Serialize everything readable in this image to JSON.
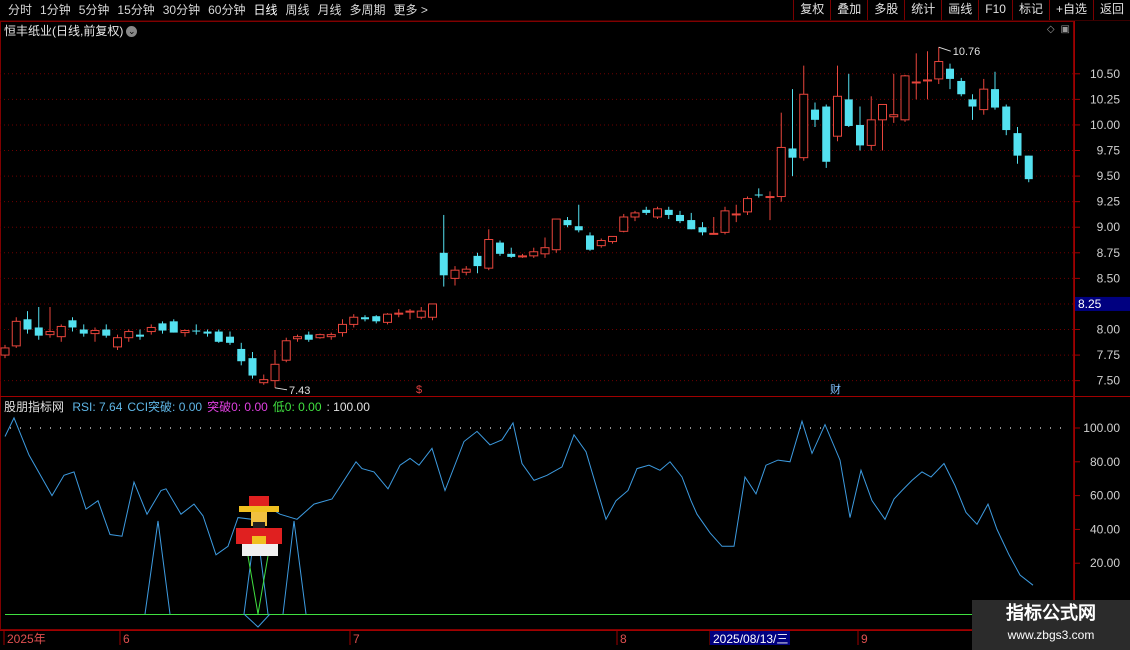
{
  "toolbar": {
    "periods": [
      "分时",
      "1分钟",
      "5分钟",
      "15分钟",
      "30分钟",
      "60分钟",
      "日线",
      "周线",
      "月线",
      "多周期",
      "更多 >"
    ],
    "active_index": 6,
    "right_buttons": [
      "复权",
      "叠加",
      "多股",
      "统计",
      "画线",
      "F10",
      "标记",
      "+自选",
      "返回"
    ]
  },
  "header": {
    "title": "恒丰纸业(日线,前复权)",
    "dropdown_icon": "chevron-down-icon",
    "right_icons": [
      "diamond-icon",
      "window-icon"
    ]
  },
  "price_axis": {
    "ticks": [
      "10.50",
      "10.25",
      "10.00",
      "9.75",
      "9.50",
      "9.25",
      "9.00",
      "8.75",
      "8.50",
      "8.25",
      "8.00",
      "7.75",
      "7.50"
    ],
    "current_price": "8.25",
    "current_price_color": "#000080"
  },
  "annotations": {
    "high_label": "10.76",
    "low_label": "7.43",
    "event_mark_1": "$",
    "event_mark_2": "财"
  },
  "indicator": {
    "name": "股朋指标网",
    "items": [
      {
        "text": "RSI: 7.64",
        "color": "#5fb6e6"
      },
      {
        "text": "CCI突破: 0.00",
        "color": "#5fb6e6"
      },
      {
        "text": "突破0: 0.00",
        "color": "#e040e0"
      },
      {
        "text": "低0: 0.00",
        "color": "#40e040"
      },
      {
        "text": ": 100.00",
        "color": "#e0e0e0"
      }
    ],
    "axis_ticks": [
      "100.00",
      "80.00",
      "60.00",
      "40.00",
      "20.00"
    ]
  },
  "time_axis": {
    "labels": [
      "2025年",
      "6",
      "7",
      "8",
      "2025/08/13/三",
      "9"
    ]
  },
  "watermark": {
    "line1": "指标公式网",
    "line2": "www.zbgs3.com"
  },
  "colors": {
    "up": "#e8453c",
    "down": "#54e1f0",
    "grid": "#6e0000",
    "rsi": "#3d9be0",
    "zero_line": "#40e040"
  },
  "chart_data": {
    "type": "candlestick",
    "y_range": [
      7.35,
      10.85
    ],
    "candles": [
      {
        "o": 7.75,
        "h": 7.85,
        "l": 7.72,
        "c": 7.82
      },
      {
        "o": 7.84,
        "h": 8.12,
        "l": 7.82,
        "c": 8.08
      },
      {
        "o": 8.1,
        "h": 8.18,
        "l": 7.96,
        "c": 8.0
      },
      {
        "o": 8.02,
        "h": 8.22,
        "l": 7.9,
        "c": 7.94
      },
      {
        "o": 7.95,
        "h": 8.22,
        "l": 7.92,
        "c": 7.98
      },
      {
        "o": 7.93,
        "h": 8.05,
        "l": 7.88,
        "c": 8.03
      },
      {
        "o": 8.09,
        "h": 8.12,
        "l": 7.98,
        "c": 8.02
      },
      {
        "o": 8.0,
        "h": 8.05,
        "l": 7.93,
        "c": 7.96
      },
      {
        "o": 7.96,
        "h": 8.02,
        "l": 7.88,
        "c": 7.99
      },
      {
        "o": 8.0,
        "h": 8.05,
        "l": 7.92,
        "c": 7.94
      },
      {
        "o": 7.83,
        "h": 7.95,
        "l": 7.8,
        "c": 7.92
      },
      {
        "o": 7.92,
        "h": 8.0,
        "l": 7.88,
        "c": 7.98
      },
      {
        "o": 7.95,
        "h": 8.0,
        "l": 7.9,
        "c": 7.93
      },
      {
        "o": 7.98,
        "h": 8.05,
        "l": 7.95,
        "c": 8.02
      },
      {
        "o": 8.06,
        "h": 8.08,
        "l": 7.96,
        "c": 7.99
      },
      {
        "o": 8.08,
        "h": 8.1,
        "l": 7.97,
        "c": 7.97
      },
      {
        "o": 7.97,
        "h": 8.0,
        "l": 7.93,
        "c": 7.99
      },
      {
        "o": 7.99,
        "h": 8.05,
        "l": 7.95,
        "c": 7.98
      },
      {
        "o": 7.98,
        "h": 8.0,
        "l": 7.93,
        "c": 7.96
      },
      {
        "o": 7.98,
        "h": 8.0,
        "l": 7.87,
        "c": 7.88
      },
      {
        "o": 7.93,
        "h": 7.98,
        "l": 7.85,
        "c": 7.87
      },
      {
        "o": 7.81,
        "h": 7.87,
        "l": 7.65,
        "c": 7.69
      },
      {
        "o": 7.72,
        "h": 7.78,
        "l": 7.52,
        "c": 7.55
      },
      {
        "o": 7.48,
        "h": 7.56,
        "l": 7.46,
        "c": 7.51
      },
      {
        "o": 7.5,
        "h": 7.8,
        "l": 7.43,
        "c": 7.66
      },
      {
        "o": 7.7,
        "h": 7.92,
        "l": 7.68,
        "c": 7.89
      },
      {
        "o": 7.91,
        "h": 7.95,
        "l": 7.88,
        "c": 7.93
      },
      {
        "o": 7.95,
        "h": 7.98,
        "l": 7.88,
        "c": 7.9
      },
      {
        "o": 7.92,
        "h": 7.96,
        "l": 7.91,
        "c": 7.95
      },
      {
        "o": 7.93,
        "h": 7.97,
        "l": 7.9,
        "c": 7.95
      },
      {
        "o": 7.97,
        "h": 8.1,
        "l": 7.93,
        "c": 8.05
      },
      {
        "o": 8.05,
        "h": 8.15,
        "l": 8.02,
        "c": 8.12
      },
      {
        "o": 8.12,
        "h": 8.14,
        "l": 8.08,
        "c": 8.1
      },
      {
        "o": 8.13,
        "h": 8.14,
        "l": 8.06,
        "c": 8.08
      },
      {
        "o": 8.07,
        "h": 8.16,
        "l": 8.05,
        "c": 8.15
      },
      {
        "o": 8.15,
        "h": 8.2,
        "l": 8.12,
        "c": 8.16
      },
      {
        "o": 8.17,
        "h": 8.2,
        "l": 8.1,
        "c": 8.18
      },
      {
        "o": 8.12,
        "h": 8.22,
        "l": 8.1,
        "c": 8.18
      },
      {
        "o": 8.12,
        "h": 8.22,
        "l": 8.09,
        "c": 8.25
      },
      {
        "o": 8.75,
        "h": 9.12,
        "l": 8.42,
        "c": 8.53
      },
      {
        "o": 8.5,
        "h": 8.62,
        "l": 8.43,
        "c": 8.58
      },
      {
        "o": 8.56,
        "h": 8.62,
        "l": 8.53,
        "c": 8.59
      },
      {
        "o": 8.72,
        "h": 8.75,
        "l": 8.55,
        "c": 8.62
      },
      {
        "o": 8.6,
        "h": 8.98,
        "l": 8.58,
        "c": 8.88
      },
      {
        "o": 8.85,
        "h": 8.87,
        "l": 8.72,
        "c": 8.74
      },
      {
        "o": 8.74,
        "h": 8.8,
        "l": 8.7,
        "c": 8.71
      },
      {
        "o": 8.71,
        "h": 8.74,
        "l": 8.7,
        "c": 8.72
      },
      {
        "o": 8.72,
        "h": 8.8,
        "l": 8.7,
        "c": 8.76
      },
      {
        "o": 8.74,
        "h": 8.9,
        "l": 8.7,
        "c": 8.8
      },
      {
        "o": 8.78,
        "h": 9.08,
        "l": 8.75,
        "c": 9.08
      },
      {
        "o": 9.07,
        "h": 9.1,
        "l": 9.0,
        "c": 9.02
      },
      {
        "o": 9.01,
        "h": 9.22,
        "l": 8.95,
        "c": 8.97
      },
      {
        "o": 8.92,
        "h": 8.95,
        "l": 8.77,
        "c": 8.78
      },
      {
        "o": 8.82,
        "h": 8.89,
        "l": 8.8,
        "c": 8.87
      },
      {
        "o": 8.86,
        "h": 8.91,
        "l": 8.84,
        "c": 8.91
      },
      {
        "o": 8.96,
        "h": 9.13,
        "l": 8.95,
        "c": 9.1
      },
      {
        "o": 9.1,
        "h": 9.16,
        "l": 9.06,
        "c": 9.14
      },
      {
        "o": 9.17,
        "h": 9.2,
        "l": 9.12,
        "c": 9.14
      },
      {
        "o": 9.1,
        "h": 9.2,
        "l": 9.08,
        "c": 9.18
      },
      {
        "o": 9.17,
        "h": 9.2,
        "l": 9.08,
        "c": 9.12
      },
      {
        "o": 9.12,
        "h": 9.16,
        "l": 9.04,
        "c": 9.06
      },
      {
        "o": 9.07,
        "h": 9.14,
        "l": 8.98,
        "c": 8.98
      },
      {
        "o": 9.0,
        "h": 9.05,
        "l": 8.92,
        "c": 8.95
      },
      {
        "o": 8.94,
        "h": 9.1,
        "l": 8.93,
        "c": 8.94
      },
      {
        "o": 8.95,
        "h": 9.2,
        "l": 8.93,
        "c": 9.16
      },
      {
        "o": 9.13,
        "h": 9.22,
        "l": 9.05,
        "c": 9.13
      },
      {
        "o": 9.15,
        "h": 9.3,
        "l": 9.12,
        "c": 9.28
      },
      {
        "o": 9.32,
        "h": 9.38,
        "l": 9.29,
        "c": 9.31
      },
      {
        "o": 9.3,
        "h": 9.35,
        "l": 9.07,
        "c": 9.3
      },
      {
        "o": 9.3,
        "h": 10.12,
        "l": 9.25,
        "c": 9.78
      },
      {
        "o": 9.77,
        "h": 10.35,
        "l": 9.5,
        "c": 9.68
      },
      {
        "o": 9.68,
        "h": 10.58,
        "l": 9.65,
        "c": 10.3
      },
      {
        "o": 10.15,
        "h": 10.22,
        "l": 9.98,
        "c": 10.05
      },
      {
        "o": 10.18,
        "h": 10.2,
        "l": 9.58,
        "c": 9.64
      },
      {
        "o": 9.89,
        "h": 10.58,
        "l": 9.84,
        "c": 10.28
      },
      {
        "o": 10.25,
        "h": 10.5,
        "l": 9.98,
        "c": 9.99
      },
      {
        "o": 10.0,
        "h": 10.18,
        "l": 9.75,
        "c": 9.8
      },
      {
        "o": 9.8,
        "h": 10.28,
        "l": 9.75,
        "c": 10.05
      },
      {
        "o": 10.05,
        "h": 10.2,
        "l": 9.75,
        "c": 10.2
      },
      {
        "o": 10.08,
        "h": 10.5,
        "l": 10.02,
        "c": 10.1
      },
      {
        "o": 10.05,
        "h": 10.49,
        "l": 10.03,
        "c": 10.48
      },
      {
        "o": 10.42,
        "h": 10.7,
        "l": 10.25,
        "c": 10.42
      },
      {
        "o": 10.43,
        "h": 10.72,
        "l": 10.25,
        "c": 10.44
      },
      {
        "o": 10.45,
        "h": 10.76,
        "l": 10.4,
        "c": 10.62
      },
      {
        "o": 10.55,
        "h": 10.6,
        "l": 10.35,
        "c": 10.45
      },
      {
        "o": 10.43,
        "h": 10.46,
        "l": 10.28,
        "c": 10.3
      },
      {
        "o": 10.25,
        "h": 10.3,
        "l": 10.05,
        "c": 10.18
      },
      {
        "o": 10.15,
        "h": 10.45,
        "l": 10.1,
        "c": 10.35
      },
      {
        "o": 10.35,
        "h": 10.52,
        "l": 10.15,
        "c": 10.17
      },
      {
        "o": 10.18,
        "h": 10.2,
        "l": 9.9,
        "c": 9.95
      },
      {
        "o": 9.92,
        "h": 9.98,
        "l": 9.62,
        "c": 9.7
      },
      {
        "o": 9.7,
        "h": 9.7,
        "l": 9.44,
        "c": 9.47
      }
    ],
    "rsi_x_range": [
      1,
      1034
    ],
    "rsi_points": [
      [
        5,
        95
      ],
      [
        14,
        106
      ],
      [
        29,
        84
      ],
      [
        52,
        60
      ],
      [
        64,
        72
      ],
      [
        74,
        74
      ],
      [
        86,
        52
      ],
      [
        98,
        57
      ],
      [
        110,
        37
      ],
      [
        122,
        36
      ],
      [
        134,
        68
      ],
      [
        147,
        49
      ],
      [
        161,
        63
      ],
      [
        166,
        64
      ],
      [
        181,
        49
      ],
      [
        194,
        55
      ],
      [
        203,
        48
      ],
      [
        216,
        25
      ],
      [
        228,
        30
      ],
      [
        238,
        47
      ],
      [
        252,
        46
      ],
      [
        264,
        55
      ],
      [
        280,
        49
      ],
      [
        297,
        46
      ],
      [
        314,
        55
      ],
      [
        332,
        58
      ],
      [
        356,
        80
      ],
      [
        362,
        76
      ],
      [
        374,
        74
      ],
      [
        388,
        64
      ],
      [
        400,
        78
      ],
      [
        410,
        82
      ],
      [
        419,
        78
      ],
      [
        432,
        88
      ],
      [
        445,
        63
      ],
      [
        464,
        92
      ],
      [
        477,
        98
      ],
      [
        490,
        90
      ],
      [
        502,
        93
      ],
      [
        513,
        103
      ],
      [
        522,
        79
      ],
      [
        534,
        69
      ],
      [
        547,
        72
      ],
      [
        562,
        77
      ],
      [
        574,
        96
      ],
      [
        586,
        86
      ],
      [
        606,
        46
      ],
      [
        616,
        57
      ],
      [
        628,
        63
      ],
      [
        637,
        76
      ],
      [
        649,
        78
      ],
      [
        660,
        75
      ],
      [
        670,
        80
      ],
      [
        682,
        71
      ],
      [
        691,
        57
      ],
      [
        697,
        49
      ],
      [
        710,
        38
      ],
      [
        722,
        30
      ],
      [
        734,
        30
      ],
      [
        745,
        71
      ],
      [
        756,
        61
      ],
      [
        766,
        78
      ],
      [
        778,
        81
      ],
      [
        790,
        80
      ],
      [
        802,
        104
      ],
      [
        812,
        85
      ],
      [
        825,
        102
      ],
      [
        840,
        81
      ],
      [
        850,
        47
      ],
      [
        861,
        75
      ],
      [
        872,
        57
      ],
      [
        885,
        46
      ],
      [
        894,
        58
      ],
      [
        902,
        63
      ],
      [
        912,
        69
      ],
      [
        922,
        74
      ],
      [
        931,
        71
      ],
      [
        944,
        79
      ],
      [
        955,
        66
      ],
      [
        966,
        50
      ],
      [
        977,
        43
      ],
      [
        988,
        55
      ],
      [
        997,
        40
      ],
      [
        1009,
        25
      ],
      [
        1020,
        13
      ],
      [
        1033,
        7
      ]
    ],
    "cci_spikes": [
      {
        "x0": 145,
        "x1": 158,
        "x2": 170
      },
      {
        "x0": 244,
        "x1": 256,
        "x2": 268
      },
      {
        "x0": 283,
        "x1": 294,
        "x2": 306
      }
    ],
    "dotted_level": 100
  }
}
